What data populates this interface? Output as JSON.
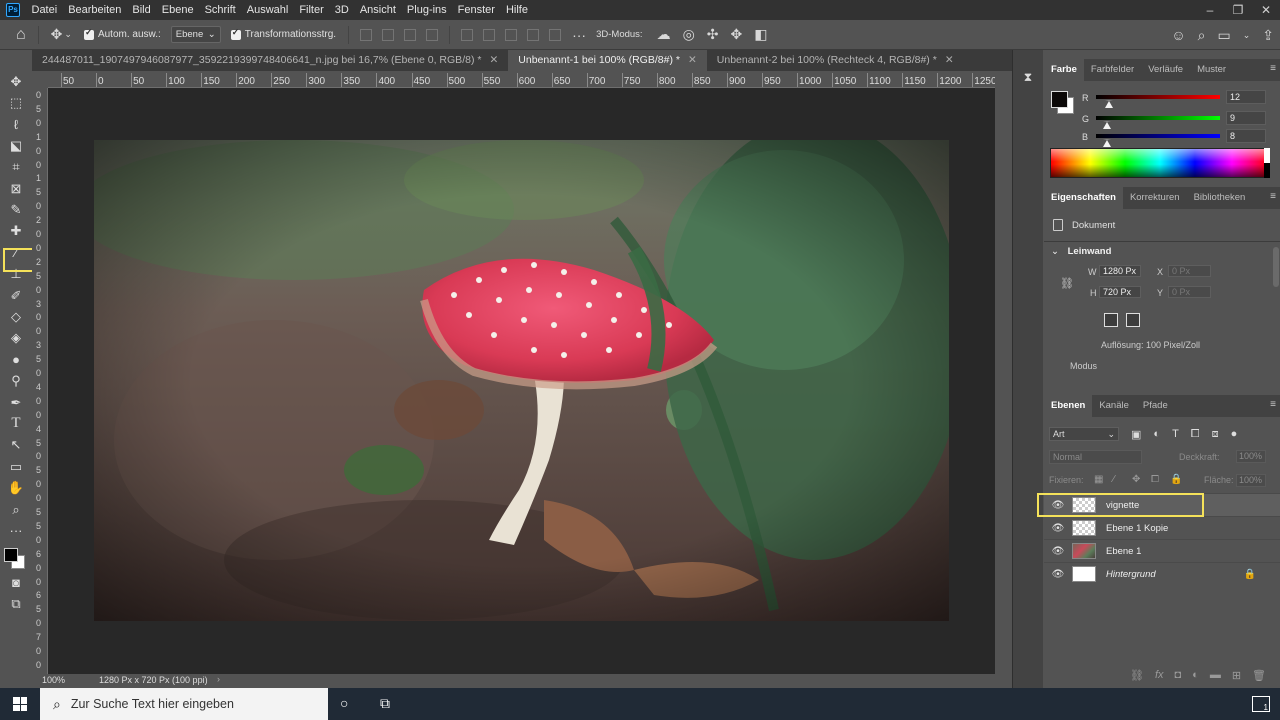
{
  "menu": {
    "logo": "Ps",
    "items": [
      "Datei",
      "Bearbeiten",
      "Bild",
      "Ebene",
      "Schrift",
      "Auswahl",
      "Filter",
      "3D",
      "Ansicht",
      "Plug-ins",
      "Fenster",
      "Hilfe"
    ]
  },
  "options": {
    "auto_select_label": "Autom. ausw.:",
    "auto_select_value": "Ebene",
    "transform_label": "Transformationsstrg.",
    "mode3d_label": "3D-Modus:"
  },
  "tabs": [
    {
      "label": "244487011_1907497946087977_3592219399748406641_n.jpg bei 16,7% (Ebene 0, RGB/8) *",
      "active": false
    },
    {
      "label": "Unbenannt-1 bei 100% (RGB/8#) *",
      "active": true
    },
    {
      "label": "Unbenannt-2 bei 100% (Rechteck 4, RGB/8#) *",
      "active": false
    }
  ],
  "ruler": {
    "h_ticks": [
      "50",
      "0",
      "50",
      "100",
      "150",
      "200",
      "250",
      "300",
      "350",
      "400",
      "450",
      "500",
      "550",
      "600",
      "650",
      "700",
      "750",
      "800",
      "850",
      "900",
      "950",
      "1000",
      "1050",
      "1100",
      "1150",
      "1200",
      "1250",
      "1300"
    ],
    "v_ticks": [
      "0",
      "5",
      "0",
      "1",
      "0",
      "0",
      "1",
      "5",
      "0",
      "2",
      "0",
      "0",
      "2",
      "5",
      "0",
      "3",
      "0",
      "0",
      "3",
      "5",
      "0",
      "4",
      "0",
      "0",
      "4",
      "5",
      "0",
      "5",
      "0",
      "0",
      "5",
      "5",
      "0",
      "6",
      "0",
      "0",
      "6",
      "5",
      "0",
      "7",
      "0",
      "0"
    ]
  },
  "status": {
    "zoom": "100%",
    "doc_info": "1280 Px x 720 Px (100 ppi)",
    "arrow": "›"
  },
  "color_panel": {
    "tabs": [
      "Farbe",
      "Farbfelder",
      "Verläufe",
      "Muster"
    ],
    "sliders": [
      {
        "label": "R",
        "value": "12",
        "level": 12,
        "max": 255
      },
      {
        "label": "G",
        "value": "9",
        "level": 9,
        "max": 255
      },
      {
        "label": "B",
        "value": "8",
        "level": 8,
        "max": 255
      }
    ],
    "foreground_color": "#0c0908"
  },
  "properties_panel": {
    "tabs": [
      "Eigenschaften",
      "Korrekturen",
      "Bibliotheken"
    ],
    "doc_label": "Dokument",
    "section": "Leinwand",
    "w_label": "W",
    "w_value": "1280 Px",
    "h_label": "H",
    "h_value": "720 Px",
    "x_label": "X",
    "x_value": "0 Px",
    "y_label": "Y",
    "y_value": "0 Px",
    "resolution": "Auflösung: 100 Pixel/Zoll",
    "mode_label": "Modus"
  },
  "layers_panel": {
    "tabs": [
      "Ebenen",
      "Kanäle",
      "Pfade"
    ],
    "filter_value": "Art",
    "blend_mode": "Normal",
    "opacity_label": "Deckkraft:",
    "opacity_value": "100%",
    "lock_label": "Fixieren:",
    "fill_label": "Fläche:",
    "fill_value": "100%",
    "layers": [
      {
        "name": "vignette",
        "thumb": "checker",
        "selected": true,
        "italic": false,
        "locked": false
      },
      {
        "name": "Ebene 1 Kopie",
        "thumb": "checker",
        "selected": false,
        "italic": false,
        "locked": false
      },
      {
        "name": "Ebene 1",
        "thumb": "photo",
        "selected": false,
        "italic": false,
        "locked": false
      },
      {
        "name": "Hintergrund",
        "thumb": "white",
        "selected": false,
        "italic": true,
        "locked": true
      }
    ]
  },
  "taskbar": {
    "search_placeholder": "Zur Suche Text hier eingeben",
    "notification_count": "1"
  },
  "colors": {
    "highlight": "#f5e25a",
    "menubar": "#323232",
    "panel": "#535353",
    "canvas_bg": "#282828",
    "taskbar": "#202a36"
  }
}
